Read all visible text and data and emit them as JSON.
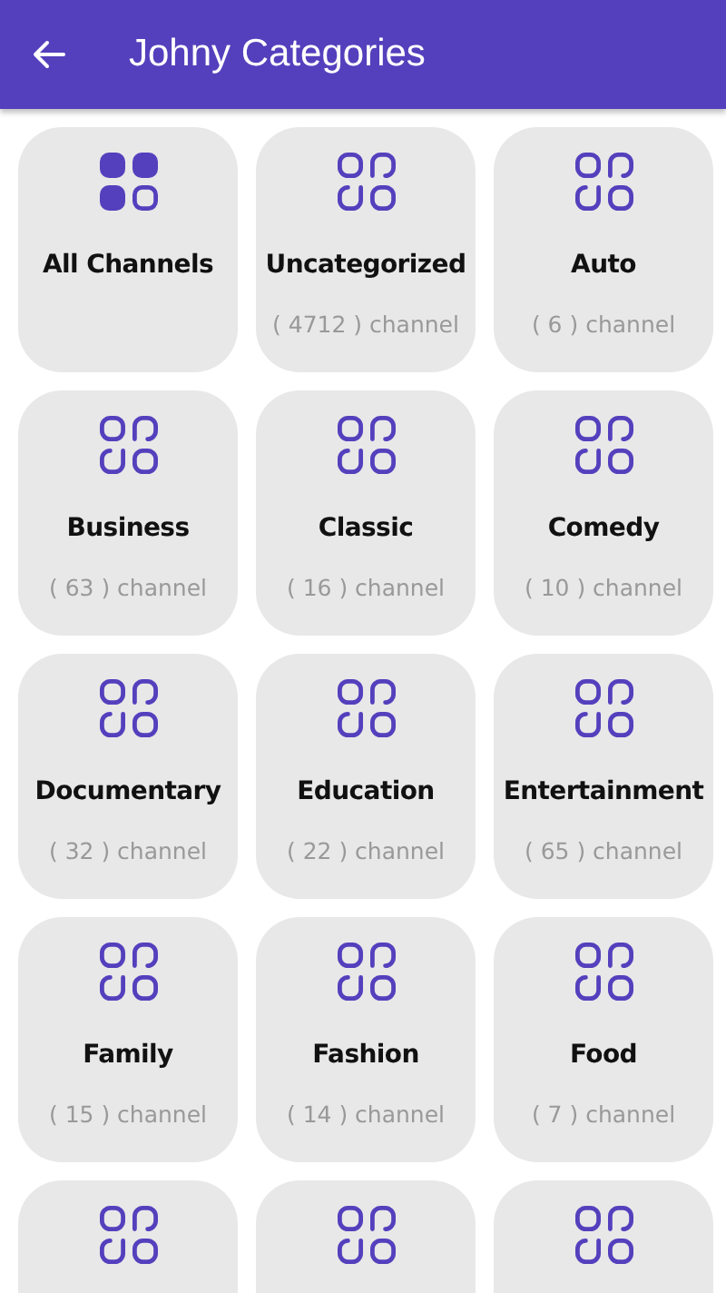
{
  "app_bar": {
    "title": "Johny Categories"
  },
  "categories": [
    {
      "kind": "all",
      "name": "All Channels"
    },
    {
      "kind": "category",
      "name": "Uncategorized",
      "count": "( 4712 ) channel"
    },
    {
      "kind": "category",
      "name": "Auto",
      "count": "( 6 ) channel"
    },
    {
      "kind": "category",
      "name": "Business",
      "count": "( 63 ) channel"
    },
    {
      "kind": "category",
      "name": "Classic",
      "count": "( 16 ) channel"
    },
    {
      "kind": "category",
      "name": "Comedy",
      "count": "( 10 ) channel"
    },
    {
      "kind": "category",
      "name": "Documentary",
      "count": "( 32 ) channel"
    },
    {
      "kind": "category",
      "name": "Education",
      "count": "( 22 ) channel"
    },
    {
      "kind": "category",
      "name": "Entertainment",
      "count": "( 65 ) channel"
    },
    {
      "kind": "category",
      "name": "Family",
      "count": "( 15 ) channel"
    },
    {
      "kind": "category",
      "name": "Fashion",
      "count": "( 14 ) channel"
    },
    {
      "kind": "category",
      "name": "Food",
      "count": "( 7 ) channel"
    },
    {
      "kind": "category"
    },
    {
      "kind": "category"
    },
    {
      "kind": "category"
    }
  ]
}
